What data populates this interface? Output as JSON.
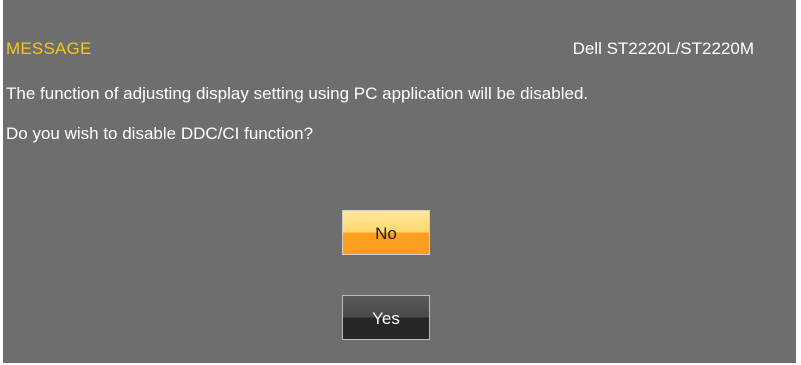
{
  "osd": {
    "title": "MESSAGE",
    "model": "Dell ST2220L/ST2220M",
    "line1": "The function of adjusting display setting using PC application will be disabled.",
    "line2": "Do you wish to disable DDC/CI function?",
    "buttons": {
      "no_label": "No",
      "yes_label": "Yes"
    },
    "selected_button": "No",
    "colors": {
      "panel_bg": "#6e6e6e",
      "title": "#f2c81a",
      "text": "#ffffff",
      "selected_button": "#ff9f20",
      "unselected_button": "#262626"
    }
  }
}
